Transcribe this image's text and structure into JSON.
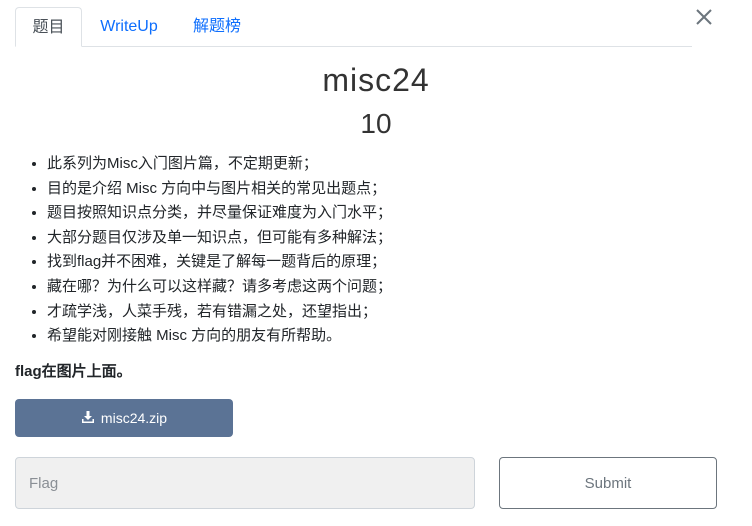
{
  "tabs": [
    {
      "label": "题目",
      "active": true
    },
    {
      "label": "WriteUp",
      "active": false
    },
    {
      "label": "解题榜",
      "active": false
    }
  ],
  "challenge": {
    "title": "misc24",
    "points": "10",
    "description": [
      "此系列为Misc入门图片篇，不定期更新；",
      "目的是介绍 Misc 方向中与图片相关的常见出题点；",
      "题目按照知识点分类，并尽量保证难度为入门水平；",
      "大部分题目仅涉及单一知识点，但可能有多种解法；",
      "找到flag并不困难，关键是了解每一题背后的原理；",
      "藏在哪？为什么可以这样藏？请多考虑这两个问题；",
      "才疏学浅，人菜手残，若有错漏之处，还望指出；",
      "希望能对刚接触 Misc 方向的朋友有所帮助。"
    ],
    "hint": "flag在图片上面。",
    "download_label": "misc24.zip"
  },
  "form": {
    "flag_placeholder": "Flag",
    "submit_label": "Submit"
  },
  "colors": {
    "tab_link": "#0d6efd",
    "download_button": "#5b7395",
    "input_background": "#f0f0f0"
  },
  "icons": {
    "close": "close-icon",
    "download": "download-icon"
  }
}
